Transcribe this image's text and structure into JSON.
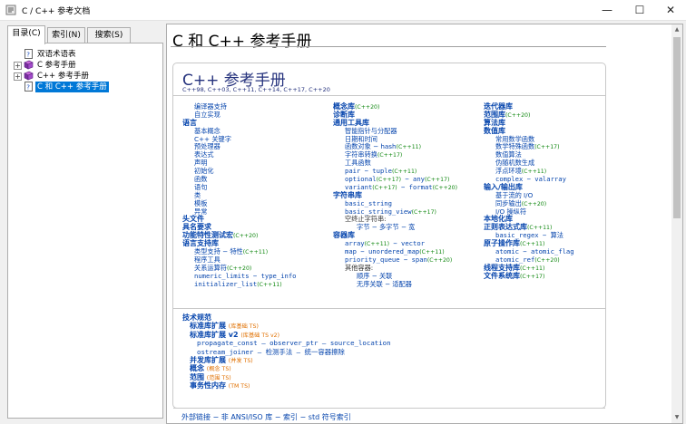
{
  "window": {
    "title": "C / C++ 参考文档",
    "min_glyph": "—",
    "max_glyph": "☐",
    "close_glyph": "✕"
  },
  "tabs": [
    {
      "label": "目录(C)",
      "active": true
    },
    {
      "label": "索引(N)",
      "active": false
    },
    {
      "label": "搜索(S)",
      "active": false
    }
  ],
  "tree": [
    {
      "label": "双语术语表",
      "expander": "",
      "selected": false
    },
    {
      "label": "C 参考手册",
      "expander": "+",
      "selected": false
    },
    {
      "label": "C++ 参考手册",
      "expander": "+",
      "selected": false
    },
    {
      "label": "C 和 C++ 参考手册",
      "expander": "",
      "selected": true
    }
  ],
  "page": {
    "title": "C 和 C++ 参考手册",
    "panel_title": "C++ 参考手册",
    "panel_subtitle": "C++98, C++03, C++11, C++14, C++17, C++20"
  },
  "columns": {
    "c1": [
      {
        "t": "编译器支持",
        "l": "s2"
      },
      {
        "t": "自立实现",
        "l": "s2"
      },
      {
        "t": "语言",
        "l": "h"
      },
      {
        "t": "基本概念",
        "l": "s2"
      },
      {
        "t": "C++ 关键字",
        "l": "s2"
      },
      {
        "t": "预处理器",
        "l": "s2"
      },
      {
        "t": "表达式",
        "l": "s2"
      },
      {
        "t": "声明",
        "l": "s2"
      },
      {
        "t": "初始化",
        "l": "s2"
      },
      {
        "t": "函数",
        "l": "s2"
      },
      {
        "t": "语句",
        "l": "s2"
      },
      {
        "t": "类",
        "l": "s2"
      },
      {
        "t": "模板",
        "l": "s2"
      },
      {
        "t": "异常",
        "l": "s2"
      },
      {
        "t": "头文件",
        "l": "h"
      },
      {
        "t": "具名要求",
        "l": "h"
      },
      {
        "t": "功能特性测试宏",
        "v": "(C++20)",
        "l": "h"
      },
      {
        "t": "语言支持库",
        "l": "h"
      },
      {
        "t": "类型支持 − 特性",
        "v": "(C++11)",
        "l": "s2"
      },
      {
        "t": "程序工具",
        "l": "s2"
      },
      {
        "t": "关系运算符",
        "v": "(C++20)",
        "l": "s2"
      },
      {
        "t": "numeric_limits − type_info",
        "l": "s2",
        "m": true
      },
      {
        "t": "initializer_list",
        "v": "(C++11)",
        "l": "s2",
        "m": true
      }
    ],
    "c2": [
      {
        "t": "概念库",
        "v": "(C++20)",
        "l": "h"
      },
      {
        "t": "诊断库",
        "l": "h"
      },
      {
        "t": "通用工具库",
        "l": "h"
      },
      {
        "t": "智能指针与分配器",
        "l": "s2"
      },
      {
        "t": "日期和时间",
        "l": "s2"
      },
      {
        "t": "函数对象 − hash",
        "v": "(C++11)",
        "l": "s2"
      },
      {
        "t": "字符串转换",
        "v": "(C++17)",
        "l": "s2"
      },
      {
        "t": "工具函数",
        "l": "s2"
      },
      {
        "t": "pair − tuple",
        "v": "(C++11)",
        "l": "s2",
        "m": true
      },
      {
        "t": "optional",
        "v": "(C++17)",
        "t2": " − any",
        "v2": "(C++17)",
        "l": "s2",
        "m": true
      },
      {
        "t": "variant",
        "v": "(C++17)",
        "t2": " − format",
        "v2": "(C++20)",
        "l": "s2",
        "m": true
      },
      {
        "t": "字符串库",
        "l": "h"
      },
      {
        "t": "basic_string",
        "l": "s2",
        "m": true
      },
      {
        "t": "basic_string_view",
        "v": "(C++17)",
        "l": "s2",
        "m": true
      },
      {
        "t": "空终止字符串:",
        "l": "s2",
        "k": true
      },
      {
        "t": "字节 − 多字节 − 宽",
        "l": "s2",
        "ind": true
      },
      {
        "t": "容器库",
        "l": "h"
      },
      {
        "t": "array",
        "v": "(C++11)",
        "t2": " − vector",
        "l": "s2",
        "m": true
      },
      {
        "t": "map − unordered_map",
        "v": "(C++11)",
        "l": "s2",
        "m": true
      },
      {
        "t": "priority_queue − span",
        "v": "(C++20)",
        "l": "s2",
        "m": true
      },
      {
        "t": "其他容器:",
        "l": "s2",
        "k": true
      },
      {
        "t": "顺序 − 关联",
        "l": "s2",
        "ind": true
      },
      {
        "t": "无序关联 − 适配器",
        "l": "s2",
        "ind": true
      }
    ],
    "c3": [
      {
        "t": "迭代器库",
        "l": "h"
      },
      {
        "t": "范围库",
        "v": "(C++20)",
        "l": "h"
      },
      {
        "t": "算法库",
        "l": "h"
      },
      {
        "t": "数值库",
        "l": "h"
      },
      {
        "t": "常用数学函数",
        "l": "s2"
      },
      {
        "t": "数学特殊函数",
        "v": "(C++17)",
        "l": "s2"
      },
      {
        "t": "数值算法",
        "l": "s2"
      },
      {
        "t": "伪随机数生成",
        "l": "s2"
      },
      {
        "t": "浮点环境",
        "v": "(C++11)",
        "l": "s2"
      },
      {
        "t": "complex − valarray",
        "l": "s2",
        "m": true
      },
      {
        "t": "输入/输出库",
        "l": "h"
      },
      {
        "t": "基于流的 I/O",
        "l": "s2"
      },
      {
        "t": "同步输出",
        "v": "(C++20)",
        "l": "s2"
      },
      {
        "t": "I/O 操纵符",
        "l": "s2"
      },
      {
        "t": "本地化库",
        "l": "h"
      },
      {
        "t": "正则表达式库",
        "v": "(C++11)",
        "l": "h"
      },
      {
        "t": "basic_regex − 算法",
        "l": "s2",
        "m": true
      },
      {
        "t": "原子操作库",
        "v": "(C++11)",
        "l": "h"
      },
      {
        "t": "atomic − atomic_flag",
        "l": "s2",
        "m": true
      },
      {
        "t": "atomic_ref",
        "v": "(C++20)",
        "l": "s2",
        "m": true
      },
      {
        "t": "线程支持库",
        "v": "(C++11)",
        "l": "h"
      },
      {
        "t": "文件系统库",
        "v": "(C++17)",
        "l": "h"
      }
    ]
  },
  "tech": [
    {
      "t": "技术规范",
      "l": "h"
    },
    {
      "t": "标准库扩展",
      "ts": "(库基础 TS)",
      "l": "h s1"
    },
    {
      "t": "标准库扩展 v2",
      "ts": "(库基础 TS v2)",
      "l": "h s1"
    },
    {
      "t": "propagate_const — observer_ptr — source_location",
      "l": "s2",
      "m": true
    },
    {
      "t": "ostream_joiner — 检测手法 — 统一容器擦除",
      "l": "s2",
      "m": true
    },
    {
      "t": "并发库扩展",
      "ts": "(并发 TS)",
      "l": "h s1"
    },
    {
      "t": "概念",
      "ts": "(概念 TS)",
      "l": "h s1"
    },
    {
      "t": "范围",
      "ts": "(范围 TS)",
      "l": "h s1"
    },
    {
      "t": "事务性内存",
      "ts": "(TM TS)",
      "l": "h s1"
    }
  ],
  "ext_links": "外部链接 − 非 ANSI/ISO 库 − 索引 − std 符号索引"
}
